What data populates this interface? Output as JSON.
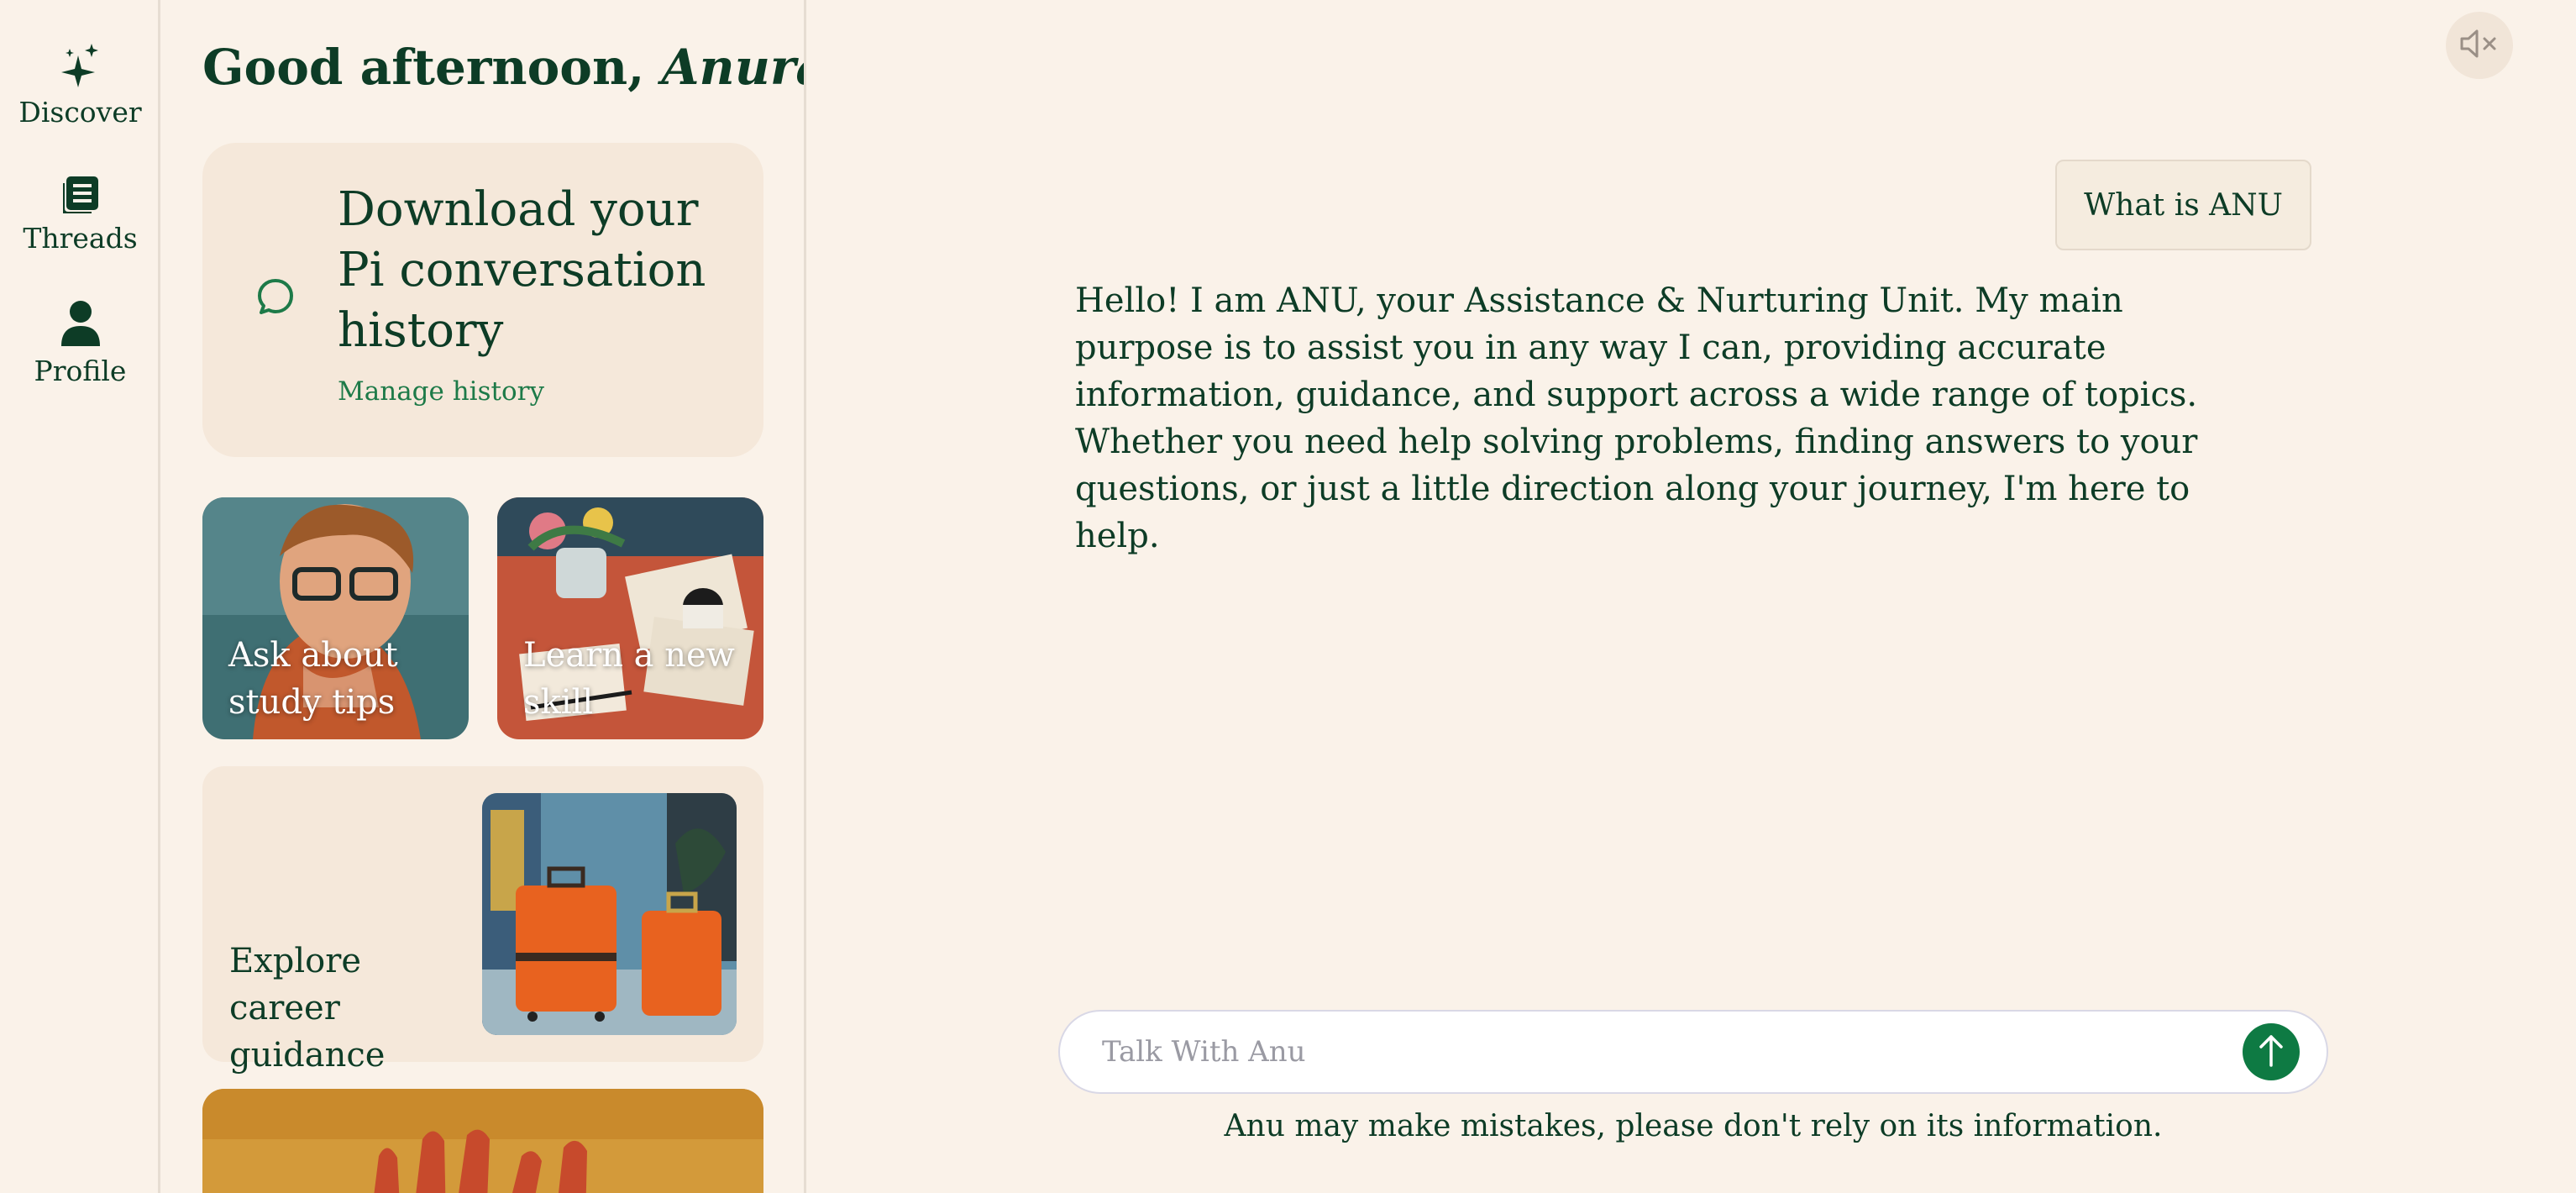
{
  "rail": {
    "items": [
      {
        "label": "Discover",
        "icon": "sparkles-icon"
      },
      {
        "label": "Threads",
        "icon": "notebook-icon"
      },
      {
        "label": "Profile",
        "icon": "person-icon"
      }
    ]
  },
  "panel": {
    "greeting_prefix": "Good afternoon, ",
    "greeting_name": "Anurag",
    "download_card": {
      "title": "Download your Pi conversation history",
      "link": "Manage history",
      "icon": "chat-bubble-icon"
    },
    "tiles": [
      {
        "label": "Ask about study tips"
      },
      {
        "label": "Learn a new skill"
      }
    ],
    "career_card": {
      "label": "Explore career guidance"
    }
  },
  "chat": {
    "user_message": "What is ANU",
    "assistant_message": "Hello! I am ANU, your Assistance & Nurturing Unit. My main purpose is to assist you in any way I can, providing accurate information, guidance, and support across a wide range of topics. Whether you need help solving problems, finding answers to your questions, or just a little direction along your journey, I'm here to help.",
    "input_placeholder": "Talk With Anu",
    "input_value": "",
    "disclaimer": "Anu may make mistakes, please don't rely on its information.",
    "mute_icon": "speaker-muted-icon",
    "send_icon": "arrow-up-icon"
  },
  "colors": {
    "background": "#faf2e9",
    "card": "#f5e8da",
    "text": "#0d3c26",
    "accent": "#0e7a43",
    "link": "#1d7a48"
  }
}
